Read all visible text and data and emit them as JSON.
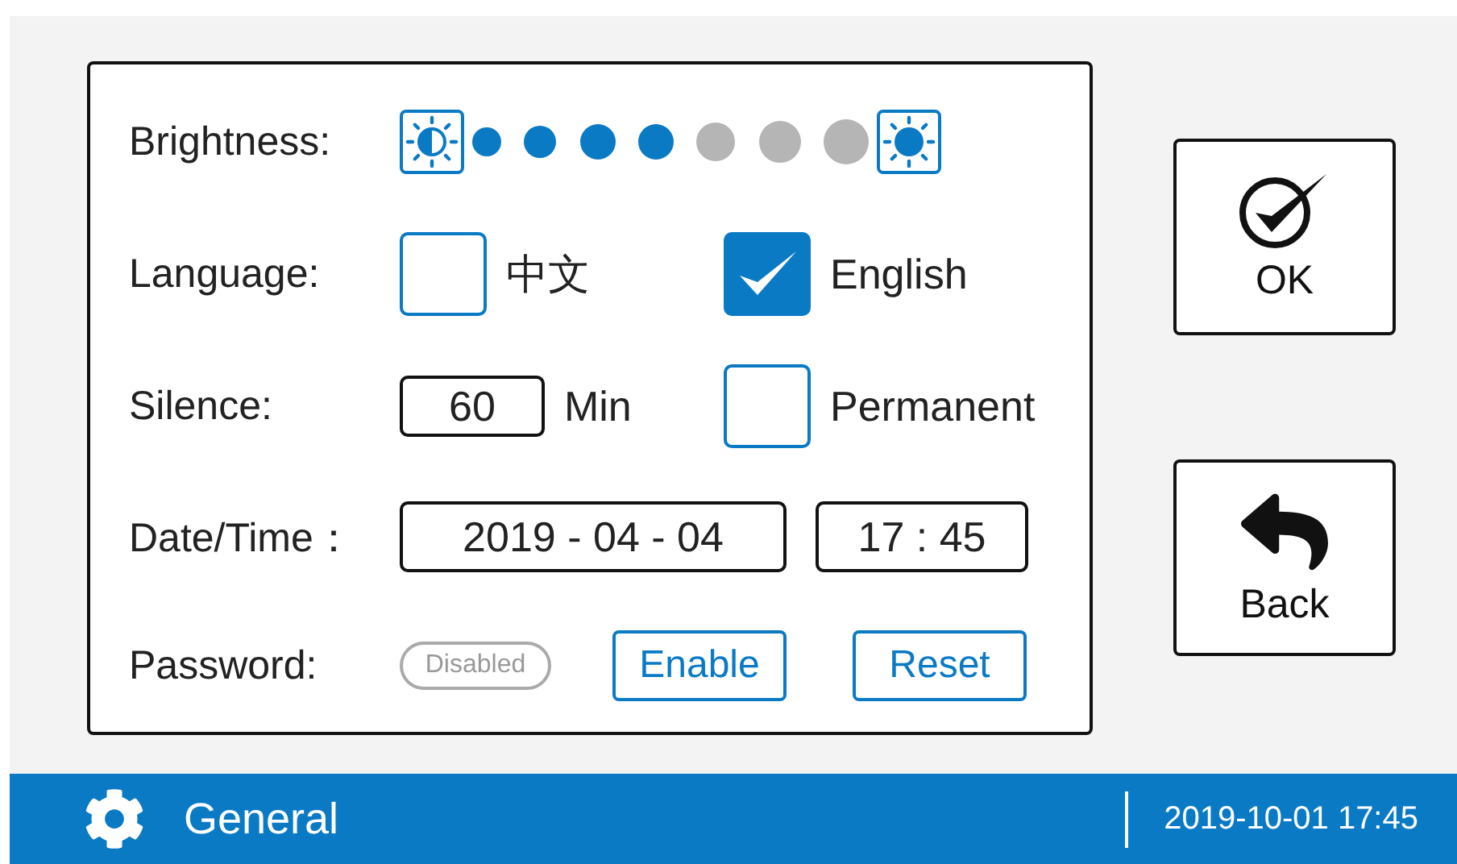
{
  "settings": {
    "brightness": {
      "label": "Brightness:",
      "level": 0.57
    },
    "language": {
      "label": "Language:",
      "options": [
        {
          "label": "中文",
          "checked": false
        },
        {
          "label": "English",
          "checked": true
        }
      ]
    },
    "silence": {
      "label": "Silence:",
      "value": "60",
      "unit": "Min",
      "permanent": {
        "label": "Permanent",
        "checked": false
      }
    },
    "datetime": {
      "label": "Date/Time：",
      "date": "2019 - 04 - 04",
      "time": "17 : 45"
    },
    "password": {
      "label": "Password:",
      "status": "Disabled",
      "buttons": [
        "Enable",
        "Reset"
      ]
    }
  },
  "side_buttons": [
    {
      "kind": "ok",
      "label": "OK"
    },
    {
      "kind": "back",
      "label": "Back"
    }
  ],
  "status_bar": {
    "title": "General",
    "datetime": "2019-10-01  17:45"
  }
}
